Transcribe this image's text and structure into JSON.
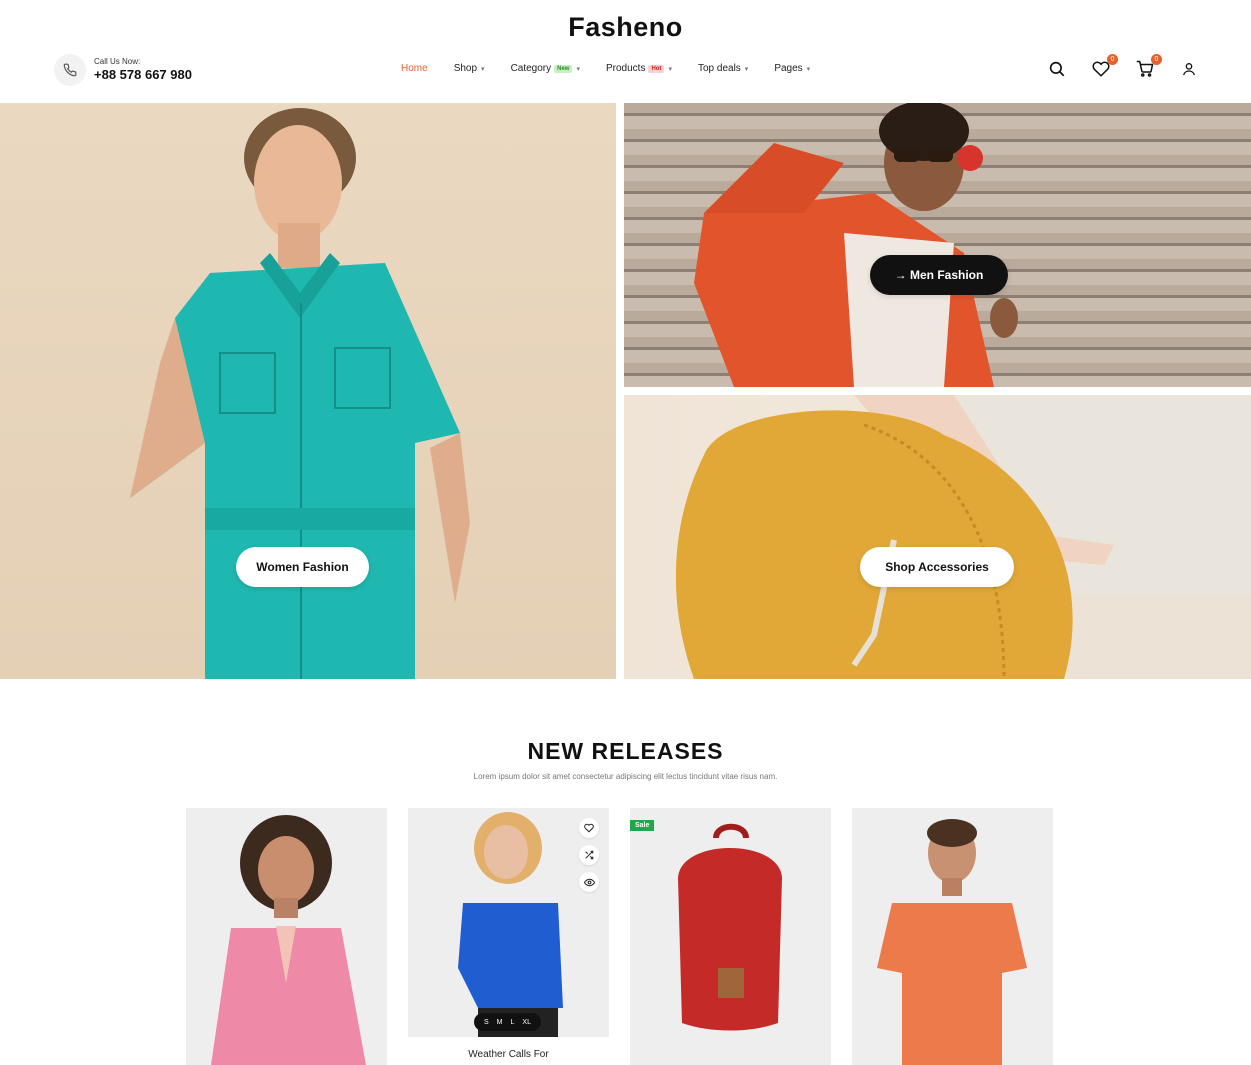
{
  "brand": {
    "logo": "Fasheno",
    "accent_color": "#e8602c"
  },
  "contact": {
    "label": "Call Us Now:",
    "phone": "+88 578 667 980",
    "icon": "phone-icon"
  },
  "nav": {
    "items": [
      {
        "label": "Home",
        "active": true
      },
      {
        "label": "Shop",
        "dropdown": true
      },
      {
        "label": "Category",
        "tag": "New",
        "dropdown": true
      },
      {
        "label": "Products",
        "tag": "Hot",
        "dropdown": true
      },
      {
        "label": "Top deals",
        "dropdown": true
      },
      {
        "label": "Pages",
        "dropdown": true
      }
    ]
  },
  "header_icons": {
    "search": "search-icon",
    "wishlist": {
      "icon": "heart-icon",
      "count": "0"
    },
    "cart": {
      "icon": "cart-icon",
      "count": "0"
    },
    "account": "user-icon"
  },
  "hero": {
    "women": {
      "button": "Women Fashion"
    },
    "men": {
      "button": "→ Men Fashion"
    },
    "accessories": {
      "button": "Shop Accessories"
    }
  },
  "new_releases": {
    "title": "NEW RELEASES",
    "subtitle": "Lorem ipsum dolor sit amet consectetur adipiscing elit lectus tincidunt vitae risus nam.",
    "products": [
      {
        "image": "pink cardigan"
      },
      {
        "image": "blue sweater",
        "sizes": [
          "S",
          "M",
          "L",
          "XL"
        ],
        "name": "Weather Calls For"
      },
      {
        "image": "red backpack",
        "badge": "Sale"
      },
      {
        "image": "orange t-shirt"
      }
    ]
  }
}
